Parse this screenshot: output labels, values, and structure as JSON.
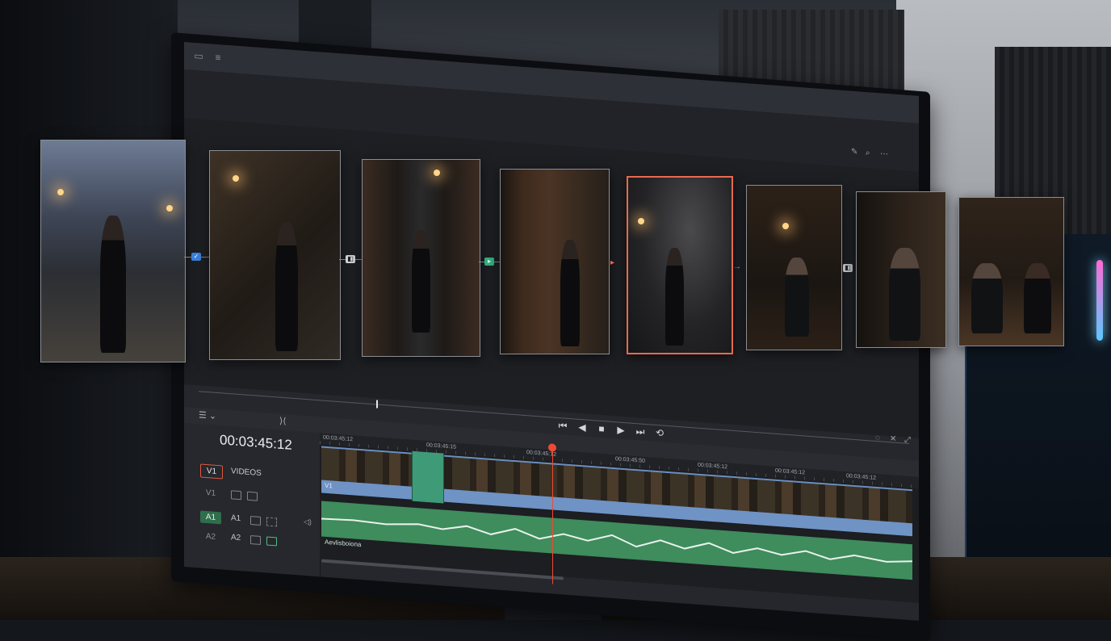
{
  "editor": {
    "timecode": "00:03:45:12",
    "tracks": [
      {
        "patch": "V1",
        "name": "VIDEOS"
      },
      {
        "patch": "",
        "name": "V1"
      },
      {
        "patch": "A1",
        "name": "A1"
      },
      {
        "patch": "",
        "name": "A2"
      }
    ],
    "ruler_timecodes": [
      "00:03:45:12",
      "00:03:45:15",
      "00:03:45:12",
      "00:03:45:50",
      "00:03:45:12",
      "00:03:45:12",
      "00:03:45:12"
    ],
    "video_clip_label": "V1",
    "audio_clip_label": "Aevlisboiona",
    "transport": {
      "prev": "⏮",
      "back": "◀",
      "stop": "■",
      "play": "▶",
      "next": "⏭",
      "loop": "⟲"
    },
    "toolbar_icons": [
      "panel-icon",
      "list-icon"
    ],
    "viewer_tools": [
      "pen-icon",
      "search-icon",
      "more-icon"
    ],
    "colors": {
      "accent_selected": "#e86a4f",
      "playhead": "#ef4a34",
      "video_clip": "#6f93c4",
      "audio_clip": "#3f8c5c",
      "transition": "#3f9a77"
    }
  },
  "storyboard": {
    "frames": [
      {
        "id": "street-night",
        "selected": false
      },
      {
        "id": "reading-note",
        "selected": false
      },
      {
        "id": "alley-walk",
        "selected": false
      },
      {
        "id": "doorway",
        "selected": false
      },
      {
        "id": "bar-entrance",
        "selected": true
      },
      {
        "id": "bar-booth",
        "selected": false
      },
      {
        "id": "closeup-man",
        "selected": false
      },
      {
        "id": "conversation",
        "selected": false
      }
    ],
    "connectors": [
      "effect-badge",
      "transition-badge",
      "effect-badge-green",
      "arrow",
      "arrow",
      "arrow",
      "arrow"
    ]
  }
}
